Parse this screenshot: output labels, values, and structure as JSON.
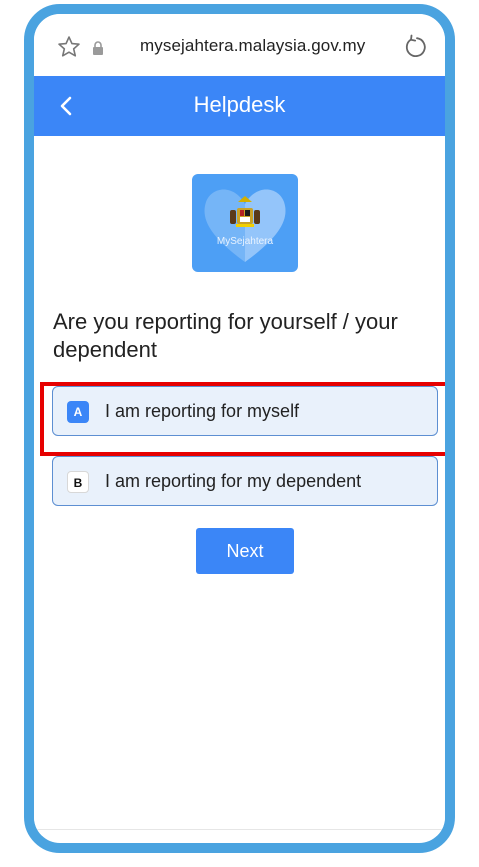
{
  "browser": {
    "url": "mysejahtera.malaysia.gov.my"
  },
  "header": {
    "title": "Helpdesk"
  },
  "logo": {
    "text": "MySejahtera"
  },
  "question": "Are you reporting for yourself / your dependent",
  "options": [
    {
      "key": "A",
      "label": "I am reporting for myself",
      "selected": true
    },
    {
      "key": "B",
      "label": "I am reporting for my dependent",
      "selected": false
    }
  ],
  "next_button": "Next",
  "colors": {
    "frame": "#4aa3e0",
    "header": "#3b86f7",
    "highlight": "#e60000",
    "option_bg": "#e9f1fb"
  }
}
